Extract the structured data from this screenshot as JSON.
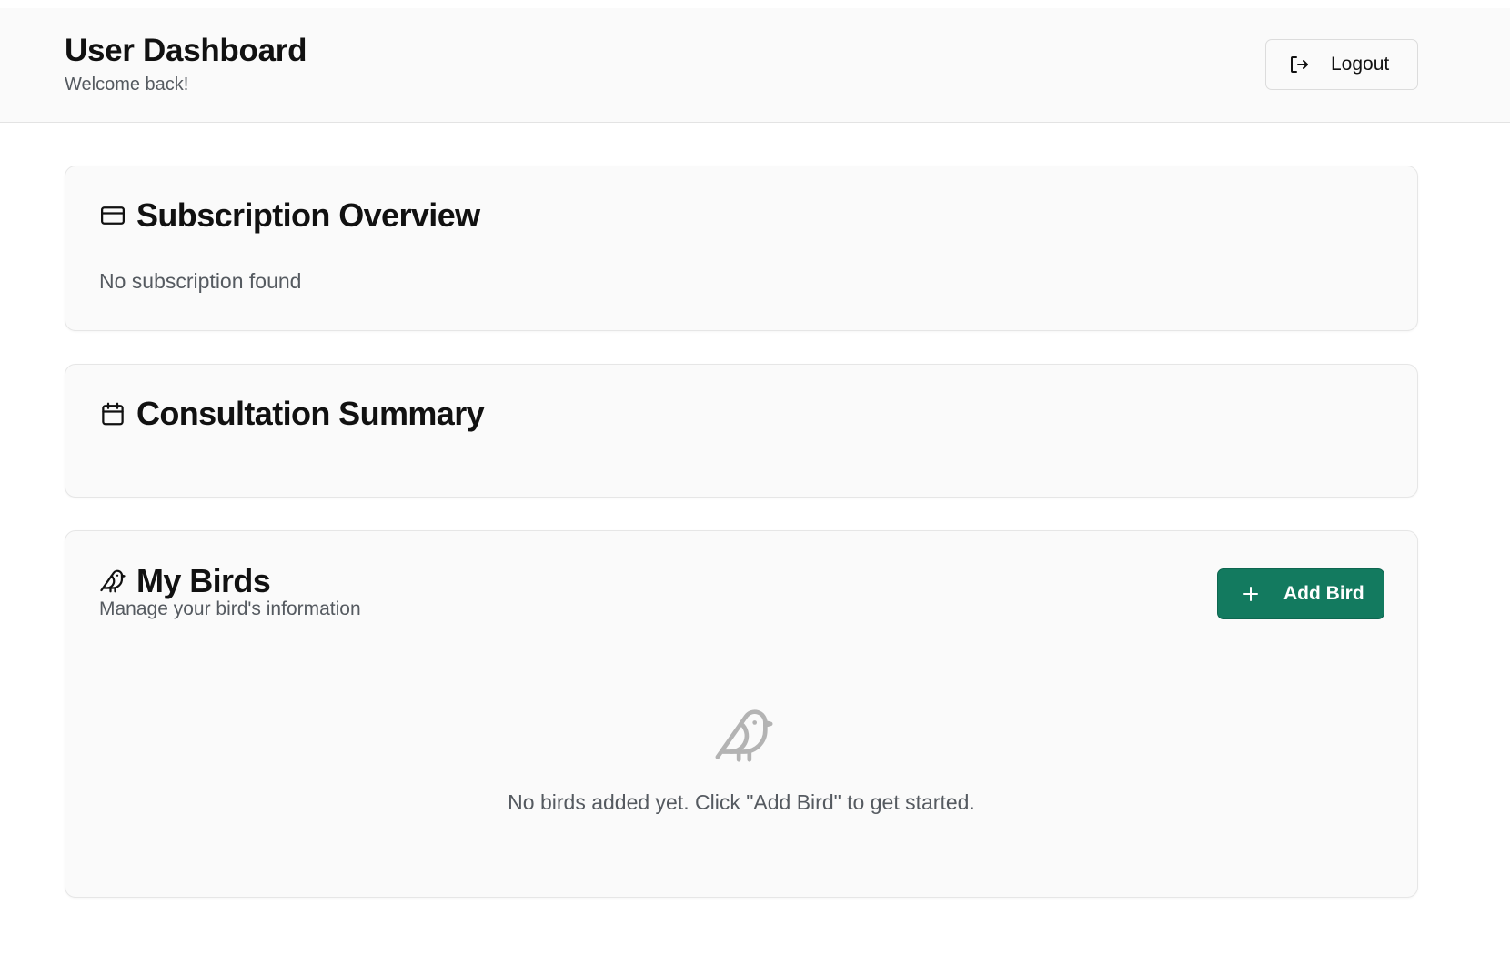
{
  "header": {
    "title": "User Dashboard",
    "subtitle": "Welcome back!",
    "logout_label": "Logout",
    "logout_icon": "logout-icon"
  },
  "subscription": {
    "title": "Subscription Overview",
    "icon": "credit-card-icon",
    "message": "No subscription found"
  },
  "consultation": {
    "title": "Consultation Summary",
    "icon": "calendar-icon"
  },
  "birds": {
    "title": "My Birds",
    "icon": "bird-icon",
    "subtitle": "Manage your bird's information",
    "add_label": "Add Bird",
    "add_icon": "plus-icon",
    "empty_icon": "bird-icon",
    "empty_message": "No birds added yet. Click \"Add Bird\" to get started."
  },
  "colors": {
    "accent": "#137a5f",
    "card_bg": "#fafafa",
    "muted_text": "#555a60"
  }
}
